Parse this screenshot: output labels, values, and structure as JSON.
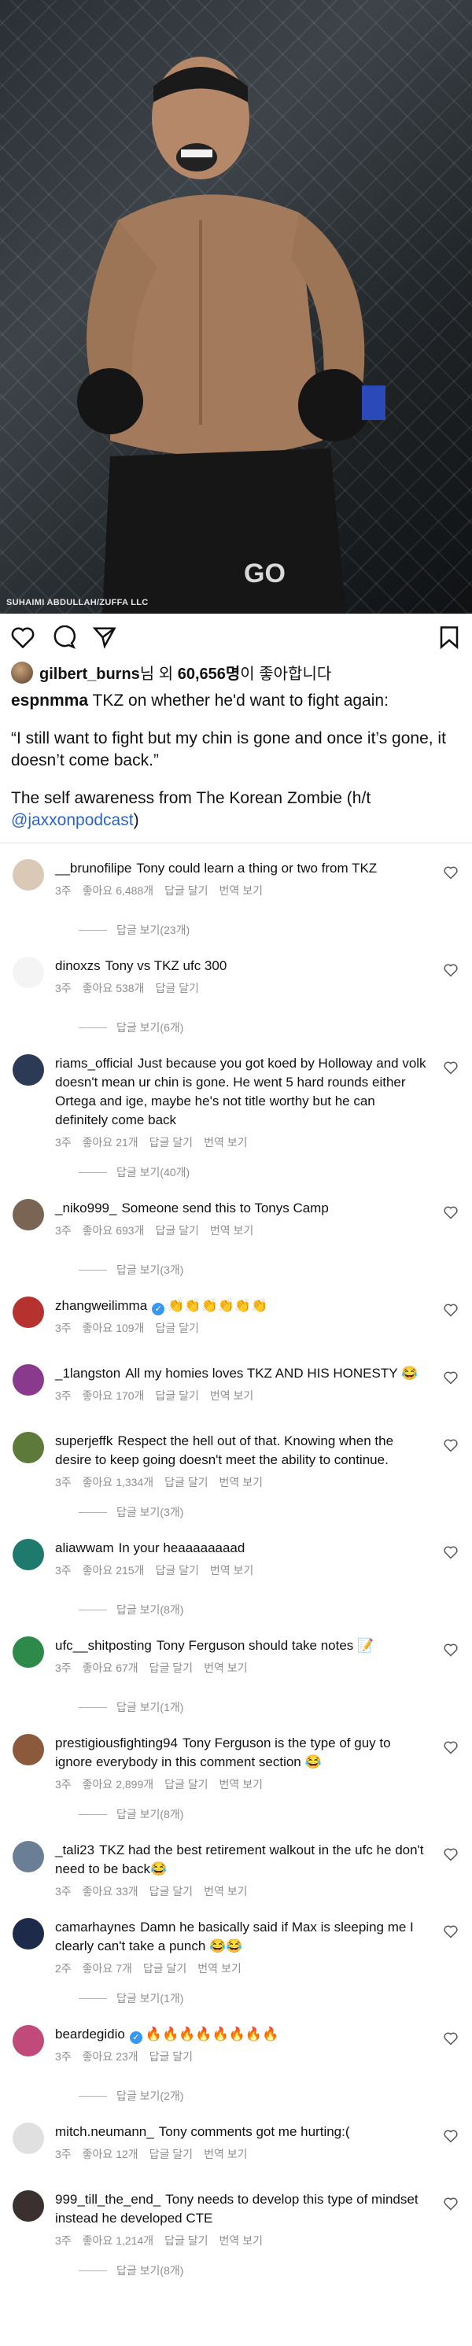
{
  "hero": {
    "credit": "SUHAIMI ABDULLAH/ZUFFA LLC"
  },
  "likes": {
    "user": "gilbert_burns",
    "suffix1": "님 외",
    "count": "60,656명",
    "suffix2": "이 좋아합니다"
  },
  "caption": {
    "user": "espnmma",
    "line1": "TKZ on whether he'd want to fight again:",
    "quote": "“I still want to fight but my chin is gone and once it’s gone, it doesn’t come back.”",
    "line3_prefix": "The self awareness from The Korean Zombie (h/t",
    "mention": "@jaxxonpodcast",
    "line3_suffix": ")"
  },
  "comments": [
    {
      "user": "__brunofilipe",
      "text": "Tony could learn a thing or two from TKZ",
      "time": "3주",
      "likes": "좋아요 6,488개",
      "reply": "답글 달기",
      "translate": "번역 보기",
      "replies": "답글 보기(23개)",
      "avatar_color": "#d9c9b6"
    },
    {
      "user": "dinoxzs",
      "text": "Tony vs TKZ ufc 300",
      "time": "3주",
      "likes": "좋아요 538개",
      "reply": "답글 달기",
      "translate": "",
      "replies": "답글 보기(6개)",
      "avatar_color": "#f4f4f4"
    },
    {
      "user": "riams_official",
      "text": "Just because you got koed by Holloway and volk doesn't mean ur chin is gone. He went 5 hard rounds either Ortega and ige, maybe he's not title worthy but he can definitely come back",
      "time": "3주",
      "likes": "좋아요 21개",
      "reply": "답글 달기",
      "translate": "번역 보기",
      "replies": "답글 보기(40개)",
      "avatar_color": "#2b3a55"
    },
    {
      "user": "_niko999_",
      "text": "Someone send this to Tonys Camp",
      "time": "3주",
      "likes": "좋아요 693개",
      "reply": "답글 달기",
      "translate": "번역 보기",
      "replies": "답글 보기(3개)",
      "avatar_color": "#7a6453"
    },
    {
      "user": "zhangweilimma",
      "verified": true,
      "text": "👏👏👏👏👏👏",
      "time": "3주",
      "likes": "좋아요 109개",
      "reply": "답글 달기",
      "translate": "",
      "replies": "",
      "avatar_color": "#b5322e"
    },
    {
      "user": "_1langston",
      "text": "All my homies loves TKZ AND HIS HONESTY 😂",
      "time": "3주",
      "likes": "좋아요 170개",
      "reply": "답글 달기",
      "translate": "번역 보기",
      "replies": "",
      "avatar_color": "#8a3a8c"
    },
    {
      "user": "superjeffk",
      "text": "Respect the hell out of that. Knowing when the desire to keep going doesn't meet the ability to continue.",
      "time": "3주",
      "likes": "좋아요 1,334개",
      "reply": "답글 달기",
      "translate": "번역 보기",
      "replies": "답글 보기(3개)",
      "avatar_color": "#5d7a3a"
    },
    {
      "user": "aliawwam",
      "text": "In your heaaaaaaaad",
      "time": "3주",
      "likes": "좋아요 215개",
      "reply": "답글 달기",
      "translate": "번역 보기",
      "replies": "답글 보기(8개)",
      "avatar_color": "#1f7a6e"
    },
    {
      "user": "ufc__shitposting",
      "text": "Tony Ferguson should take notes 📝",
      "time": "3주",
      "likes": "좋아요 67개",
      "reply": "답글 달기",
      "translate": "번역 보기",
      "replies": "답글 보기(1개)",
      "avatar_color": "#2d8a4a"
    },
    {
      "user": "prestigiousfighting94",
      "text": "Tony Ferguson is the type of guy to ignore everybody in this comment section 😂",
      "time": "3주",
      "likes": "좋아요 2,899개",
      "reply": "답글 달기",
      "translate": "번역 보기",
      "replies": "답글 보기(8개)",
      "avatar_color": "#8b5a3c"
    },
    {
      "user": "_tali23",
      "text": "TKZ had the best retirement walkout in the ufc he don't need to be back😂",
      "time": "3주",
      "likes": "좋아요 33개",
      "reply": "답글 달기",
      "translate": "번역 보기",
      "replies": "",
      "avatar_color": "#6a7f96"
    },
    {
      "user": "camarhaynes",
      "text": "Damn he basically said if Max is sleeping me I clearly can't take a punch 😂😂",
      "time": "2주",
      "likes": "좋아요 7개",
      "reply": "답글 달기",
      "translate": "번역 보기",
      "replies": "답글 보기(1개)",
      "avatar_color": "#1e2a4a"
    },
    {
      "user": "beardegidio",
      "verified": true,
      "text": "🔥🔥🔥🔥🔥🔥🔥🔥",
      "time": "3주",
      "likes": "좋아요 23개",
      "reply": "답글 달기",
      "translate": "",
      "replies": "답글 보기(2개)",
      "avatar_color": "#c04a7a"
    },
    {
      "user": "mitch.neumann_",
      "text": "Tony comments got me hurting:(",
      "time": "3주",
      "likes": "좋아요 12개",
      "reply": "답글 달기",
      "translate": "번역 보기",
      "replies": "",
      "avatar_color": "#e0e0e0"
    },
    {
      "user": "999_till_the_end_",
      "text": "Tony needs to develop this type of mindset instead he developed CTE",
      "time": "3주",
      "likes": "좋아요 1,214개",
      "reply": "답글 달기",
      "translate": "번역 보기",
      "replies": "답글 보기(8개)",
      "avatar_color": "#3a3030"
    }
  ]
}
